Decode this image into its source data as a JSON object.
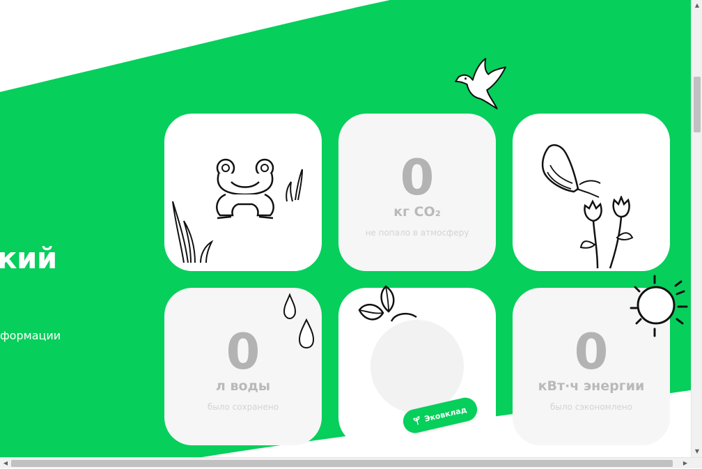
{
  "colors": {
    "accent": "#06cf5b",
    "card_grey": "#f6f6f6",
    "value_grey": "#b3b3b3"
  },
  "hero": {
    "title": "кий",
    "subtitle": "формации"
  },
  "cards": {
    "co2": {
      "value": "0",
      "unit": "кг CO₂",
      "desc": "не попало в атмосферу"
    },
    "water": {
      "value": "0",
      "unit": "л воды",
      "desc": "было сохранено"
    },
    "energy": {
      "value": "0",
      "unit": "кВт·ч энергии",
      "desc": "было сэкономлено"
    }
  },
  "eco_button": {
    "label": "Эковклад",
    "icon": "sprout-icon"
  },
  "illustrations": [
    "dove-icon",
    "frog-icon",
    "butterfly-icon",
    "flowers-icon",
    "grass-icon",
    "water-drops-icon",
    "leaves-icon",
    "sun-icon"
  ]
}
